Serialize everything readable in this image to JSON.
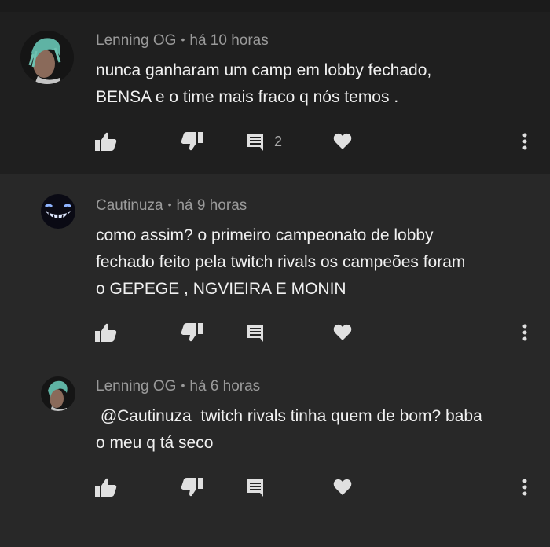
{
  "colors": {
    "background": "#282828",
    "top_comment_bg": "#1f1f1f",
    "meta_text": "#9a9a9a",
    "body_text": "#f1f1f1",
    "icon": "#e0e0e0"
  },
  "comments": [
    {
      "author": "Lenning OG",
      "separator": "•",
      "time": "há 10 horas",
      "lines": [
        "nunca ganharam um camp em lobby fechado,",
        "BENSA e o time mais fraco q nós temos ."
      ],
      "reply_count": "2",
      "avatar_icon": "user-avatar-rapper"
    },
    {
      "author": "Cautinuza",
      "separator": "•",
      "time": "há 9 horas",
      "lines": [
        "como assim? o primeiro campeonato de lobby",
        "fechado feito pela twitch rivals os campeões foram",
        "o GEPEGE , NGVIEIRA E MONIN"
      ],
      "avatar_icon": "user-avatar-grin"
    },
    {
      "author": "Lenning OG",
      "separator": "•",
      "time": "há 6 horas",
      "lines": [
        " @Cautinuza  twitch rivals tinha quem de bom? baba",
        "o meu q tá seco"
      ],
      "avatar_icon": "user-avatar-rapper"
    }
  ],
  "icons": {
    "like": "thumbs-up-icon",
    "dislike": "thumbs-down-icon",
    "reply": "comment-icon",
    "heart": "heart-icon",
    "more": "more-vert-icon"
  }
}
